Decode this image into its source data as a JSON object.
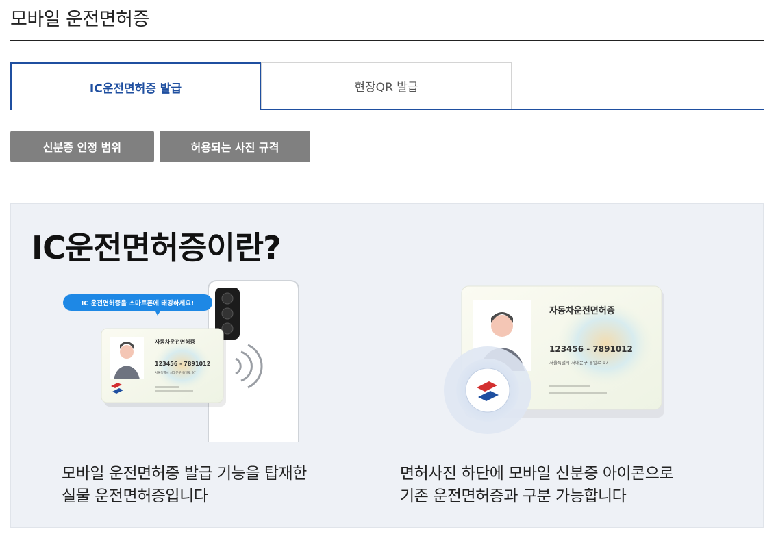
{
  "page": {
    "title": "모바일 운전면허증"
  },
  "tabs": [
    {
      "label": "IC운전면허증 발급",
      "active": true
    },
    {
      "label": "현장QR 발급",
      "active": false
    }
  ],
  "buttons": {
    "id_scope": "신분증 인정 범위",
    "photo_spec": "허용되는 사진 규격"
  },
  "panel": {
    "heading": "IC운전면허증이란?",
    "left": {
      "bubble": "IC 운전면허증을 스마트폰에 태깅하세요!",
      "card_title": "자동차운전면허증",
      "card_number": "123456 - 7891012",
      "card_address": "서울특별시 서대문구 통일로 97",
      "caption_line1": "모바일 운전면허증 발급 기능을 탑재한",
      "caption_line2": "실물 운전면허증입니다"
    },
    "right": {
      "card_title": "자동차운전면허증",
      "card_number": "123456 - 7891012",
      "card_address": "서울특별시 서대문구 통일로 97",
      "caption_line1": "면허사진 하단에 모바일 신분증 아이콘으로",
      "caption_line2": "기존 운전면허증과 구분 가능합니다"
    }
  },
  "colors": {
    "accent_blue": "#1f4fa0",
    "button_gray": "#808080",
    "panel_bg": "#eef1f6",
    "bubble_blue": "#1e88e5"
  }
}
